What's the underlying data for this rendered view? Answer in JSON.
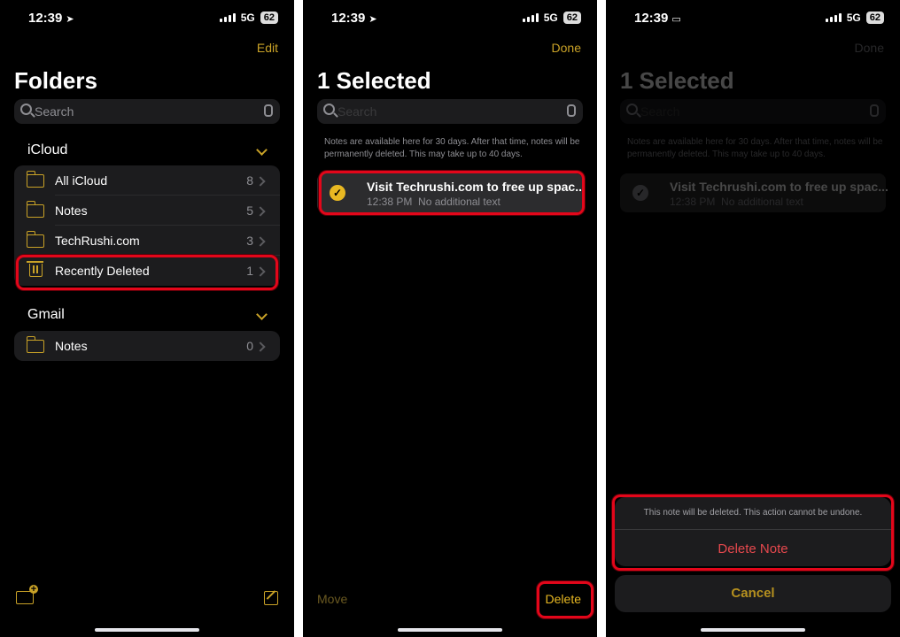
{
  "colors": {
    "accent": "#c9a227",
    "highlight": "#e3061a",
    "destructive": "#e5484d"
  },
  "status": {
    "time": "12:39",
    "network": "5G",
    "battery": "62"
  },
  "screen1": {
    "nav_button": "Edit",
    "title": "Folders",
    "search_placeholder": "Search",
    "icloud": {
      "header": "iCloud",
      "folders": [
        {
          "name": "All iCloud",
          "count": "8"
        },
        {
          "name": "Notes",
          "count": "5"
        },
        {
          "name": "TechRushi.com",
          "count": "3"
        },
        {
          "name": "Recently Deleted",
          "count": "1"
        }
      ]
    },
    "gmail": {
      "header": "Gmail",
      "folders": [
        {
          "name": "Notes",
          "count": "0"
        }
      ]
    }
  },
  "screen2": {
    "nav_button": "Done",
    "title": "1 Selected",
    "search_placeholder": "Search",
    "info": "Notes are available here for 30 days. After that time, notes will be permanently deleted. This may take up to 40 days.",
    "note": {
      "title": "Visit Techrushi.com to free up spac...",
      "time": "12:38 PM",
      "preview": "No additional text"
    },
    "move_button": "Move",
    "delete_button": "Delete"
  },
  "screen3": {
    "nav_button": "Done",
    "title": "1 Selected",
    "search_placeholder": "Search",
    "info": "Notes are available here for 30 days. After that time, notes will be permanently deleted. This may take up to 40 days.",
    "note": {
      "title": "Visit Techrushi.com to free up spac...",
      "time": "12:38 PM",
      "preview": "No additional text"
    },
    "sheet_message": "This note will be deleted. This action cannot be undone.",
    "delete_note_button": "Delete Note",
    "cancel_button": "Cancel"
  }
}
